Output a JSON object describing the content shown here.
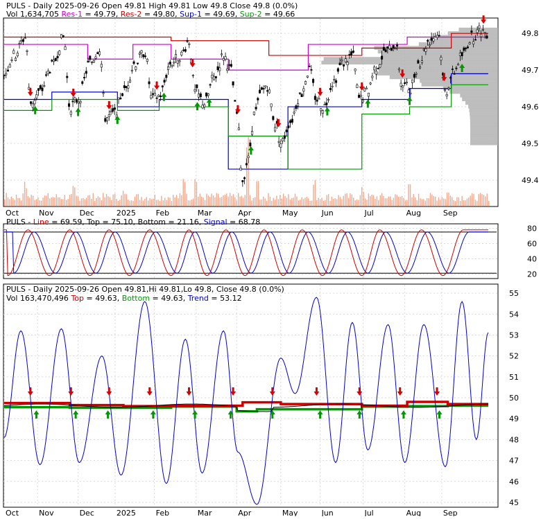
{
  "panel1": {
    "header_line1": [
      {
        "text": "PULS - Daily 2025-09-26 Open 49.81  High 49.81  Low 49.8  Close 49.8 (0.0%)",
        "color": "#000000"
      }
    ],
    "header_line2": [
      {
        "text": "Vol 1,634,705 ",
        "color": "#000000"
      },
      {
        "text": "Res-1",
        "color": "#cc00cc"
      },
      {
        "text": " = 49.79, ",
        "color": "#000000"
      },
      {
        "text": "Res-2",
        "color": "#cc0000"
      },
      {
        "text": " = 49.80, ",
        "color": "#000000"
      },
      {
        "text": "Sup-1",
        "color": "#0000cc"
      },
      {
        "text": " = 49.69, ",
        "color": "#000000"
      },
      {
        "text": "Sup-2",
        "color": "#009900"
      },
      {
        "text": " = 49.66",
        "color": "#000000"
      }
    ]
  },
  "panel2": {
    "header_line1": [
      {
        "text": "PULS - ",
        "color": "#000000"
      },
      {
        "text": "Line",
        "color": "#cc0000"
      },
      {
        "text": " = 69.59, ",
        "color": "#000000"
      },
      {
        "text": "Top",
        "color": "#000000"
      },
      {
        "text": " = 75.10, ",
        "color": "#000000"
      },
      {
        "text": "Bottom",
        "color": "#000000"
      },
      {
        "text": " = 21.16, ",
        "color": "#000000"
      },
      {
        "text": "Signal",
        "color": "#0000cc"
      },
      {
        "text": " = 68.78",
        "color": "#000000"
      }
    ]
  },
  "panel3": {
    "header_line1": [
      {
        "text": "PULS - Daily 2025-09-26 Open 49.81,Hi 49.81,Lo 49.8, Close 49.8 (0.0%)",
        "color": "#000000"
      }
    ],
    "header_line2": [
      {
        "text": "Vol 163,470,496 ",
        "color": "#000000"
      },
      {
        "text": "Top",
        "color": "#cc0000"
      },
      {
        "text": " = 49.63, ",
        "color": "#000000"
      },
      {
        "text": "Bottom",
        "color": "#009900"
      },
      {
        "text": " = 49.63, ",
        "color": "#000000"
      },
      {
        "text": "Trend",
        "color": "#0000cc"
      },
      {
        "text": " = 53.12",
        "color": "#000000"
      }
    ]
  },
  "colors": {
    "res1": "#cc00cc",
    "res2": "#cc0000",
    "sup1": "#0000cc",
    "sup2": "#009900",
    "volume": "#f4a88c",
    "profile": "#b3b3b3",
    "grid": "#d9d9d9",
    "up_arrow": "#009900",
    "down_arrow": "#dd0000"
  },
  "chart_data": [
    {
      "type": "candlestick",
      "title": "PULS - Daily 2025-09-26",
      "y_ticks": [
        "49.4",
        "49.5",
        "49.6",
        "49.7",
        "49.8"
      ],
      "ylim": [
        49.33,
        49.84
      ],
      "x_labels": [
        "Oct",
        "Nov",
        "Dec",
        "2025",
        "Feb",
        "Mar",
        "Apr",
        "May",
        "Jun",
        "Jul",
        "Aug",
        "Sep"
      ],
      "x_label_days": [
        0,
        28,
        62,
        93,
        126,
        161,
        195,
        232,
        265,
        301,
        336,
        367
      ],
      "total_days": 413,
      "grid": true,
      "last": {
        "open": 49.81,
        "high": 49.81,
        "low": 49.8,
        "close": 49.8
      },
      "series": [
        {
          "name": "Res-1",
          "value": 49.79
        },
        {
          "name": "Res-2",
          "value": 49.8
        },
        {
          "name": "Sup-1",
          "value": 49.69
        },
        {
          "name": "Sup-2",
          "value": 49.66
        }
      ],
      "price_anchors": [
        [
          0,
          49.69
        ],
        [
          8,
          49.74
        ],
        [
          18,
          49.79
        ],
        [
          22,
          49.61
        ],
        [
          30,
          49.64
        ],
        [
          40,
          49.71
        ],
        [
          50,
          49.79
        ],
        [
          55,
          49.6
        ],
        [
          62,
          49.62
        ],
        [
          72,
          49.72
        ],
        [
          80,
          49.76
        ],
        [
          85,
          49.57
        ],
        [
          92,
          49.58
        ],
        [
          100,
          49.64
        ],
        [
          110,
          49.72
        ],
        [
          118,
          49.75
        ],
        [
          124,
          49.62
        ],
        [
          130,
          49.63
        ],
        [
          140,
          49.72
        ],
        [
          148,
          49.74
        ],
        [
          155,
          49.78
        ],
        [
          160,
          49.64
        ],
        [
          168,
          49.61
        ],
        [
          176,
          49.68
        ],
        [
          184,
          49.74
        ],
        [
          190,
          49.7
        ],
        [
          195,
          49.58
        ],
        [
          200,
          49.4
        ],
        [
          204,
          49.45
        ],
        [
          210,
          49.58
        ],
        [
          216,
          49.64
        ],
        [
          220,
          49.66
        ],
        [
          228,
          49.55
        ],
        [
          232,
          49.5
        ],
        [
          240,
          49.56
        ],
        [
          248,
          49.63
        ],
        [
          256,
          49.7
        ],
        [
          262,
          49.62
        ],
        [
          268,
          49.6
        ],
        [
          276,
          49.67
        ],
        [
          284,
          49.72
        ],
        [
          292,
          49.74
        ],
        [
          298,
          49.62
        ],
        [
          304,
          49.64
        ],
        [
          312,
          49.71
        ],
        [
          320,
          49.75
        ],
        [
          328,
          49.77
        ],
        [
          334,
          49.66
        ],
        [
          340,
          49.65
        ],
        [
          348,
          49.72
        ],
        [
          356,
          49.78
        ],
        [
          364,
          49.8
        ],
        [
          370,
          49.64
        ],
        [
          376,
          49.69
        ],
        [
          384,
          49.74
        ],
        [
          392,
          49.79
        ],
        [
          400,
          49.81
        ],
        [
          406,
          49.8
        ]
      ],
      "volume_max": 23000000,
      "volume_spikes": [
        [
          17,
          8000000
        ],
        [
          58,
          6500000
        ],
        [
          100,
          5500000
        ],
        [
          150,
          12000000
        ],
        [
          160,
          10000000
        ],
        [
          204,
          23000000
        ],
        [
          212,
          9000000
        ],
        [
          260,
          8500000
        ],
        [
          300,
          6000000
        ],
        [
          340,
          7000000
        ],
        [
          372,
          5000000
        ]
      ],
      "res1_segments": [
        [
          0,
          35,
          49.77
        ],
        [
          35,
          70,
          49.77
        ],
        [
          70,
          108,
          49.73
        ],
        [
          108,
          140,
          49.77
        ],
        [
          140,
          188,
          49.73
        ],
        [
          188,
          255,
          49.7
        ],
        [
          255,
          300,
          49.77
        ],
        [
          300,
          338,
          49.77
        ],
        [
          338,
          375,
          49.79
        ],
        [
          375,
          406,
          49.79
        ]
      ],
      "res2_segments": [
        [
          0,
          70,
          49.79
        ],
        [
          70,
          140,
          49.79
        ],
        [
          140,
          222,
          49.78
        ],
        [
          222,
          300,
          49.74
        ],
        [
          300,
          375,
          49.76
        ],
        [
          375,
          406,
          49.8
        ]
      ],
      "sup1_segments": [
        [
          0,
          40,
          49.62
        ],
        [
          40,
          95,
          49.64
        ],
        [
          95,
          130,
          49.6
        ],
        [
          130,
          188,
          49.62
        ],
        [
          188,
          238,
          49.43
        ],
        [
          238,
          300,
          49.6
        ],
        [
          300,
          340,
          49.62
        ],
        [
          340,
          375,
          49.65
        ],
        [
          375,
          406,
          49.69
        ]
      ],
      "sup2_segments": [
        [
          0,
          40,
          49.59
        ],
        [
          40,
          95,
          49.62
        ],
        [
          95,
          130,
          49.59
        ],
        [
          130,
          188,
          49.6
        ],
        [
          188,
          238,
          49.52
        ],
        [
          238,
          300,
          49.43
        ],
        [
          300,
          340,
          49.58
        ],
        [
          340,
          375,
          49.6
        ],
        [
          375,
          406,
          49.66
        ]
      ],
      "buy_days": [
        26,
        62,
        95,
        134,
        162,
        172,
        207,
        271,
        305,
        340,
        384
      ],
      "sell_days": [
        22,
        58,
        88,
        128,
        158,
        196,
        230,
        265,
        300,
        334,
        369,
        402
      ]
    },
    {
      "type": "line",
      "title": "PULS - Line",
      "y_ticks": [
        "20",
        "40",
        "60",
        "80"
      ],
      "ylim": [
        15,
        85
      ],
      "series": [
        {
          "name": "Line",
          "last": 69.59
        },
        {
          "name": "Signal",
          "last": 68.78
        }
      ],
      "top_value": 75.1,
      "bottom_value": 21.16,
      "peak_days": [
        20,
        55,
        88,
        122,
        155,
        186,
        218,
        250,
        283,
        315,
        350,
        385,
        406
      ],
      "trough_days": [
        3,
        38,
        72,
        105,
        140,
        170,
        202,
        234,
        267,
        300,
        333,
        368
      ]
    },
    {
      "type": "line",
      "title": "PULS - Daily 2025-09-26",
      "y_ticks": [
        "45",
        "46",
        "47",
        "48",
        "49",
        "50",
        "51",
        "52",
        "53",
        "54",
        "55"
      ],
      "ylim": [
        44.8,
        55.4
      ],
      "series": [
        {
          "name": "Top",
          "value": 49.63
        },
        {
          "name": "Bottom",
          "value": 49.63
        },
        {
          "name": "Trend",
          "value": 53.12
        }
      ],
      "trend_anchors": [
        [
          0,
          48.1
        ],
        [
          14,
          53.2
        ],
        [
          30,
          46.8
        ],
        [
          48,
          53.3
        ],
        [
          63,
          46.9
        ],
        [
          82,
          52.0
        ],
        [
          98,
          46.3
        ],
        [
          118,
          54.6
        ],
        [
          136,
          45.9
        ],
        [
          152,
          52.8
        ],
        [
          166,
          46.4
        ],
        [
          184,
          53.2
        ],
        [
          196,
          47.4
        ],
        [
          212,
          44.9
        ],
        [
          232,
          51.9
        ],
        [
          244,
          50.2
        ],
        [
          262,
          54.8
        ],
        [
          278,
          46.9
        ],
        [
          292,
          53.6
        ],
        [
          305,
          47.5
        ],
        [
          322,
          53.5
        ],
        [
          336,
          46.9
        ],
        [
          352,
          53.5
        ],
        [
          370,
          46.7
        ],
        [
          384,
          54.6
        ],
        [
          396,
          48.0
        ],
        [
          406,
          53.12
        ]
      ],
      "top_segments": [
        [
          0,
          55,
          49.75
        ],
        [
          55,
          100,
          49.65
        ],
        [
          100,
          140,
          49.6
        ],
        [
          140,
          200,
          49.62
        ],
        [
          200,
          232,
          49.78
        ],
        [
          232,
          300,
          49.7
        ],
        [
          300,
          338,
          49.62
        ],
        [
          338,
          372,
          49.8
        ],
        [
          372,
          406,
          49.7
        ]
      ],
      "bottom_segments": [
        [
          0,
          55,
          49.55
        ],
        [
          55,
          100,
          49.52
        ],
        [
          100,
          140,
          49.52
        ],
        [
          140,
          195,
          49.58
        ],
        [
          195,
          212,
          49.35
        ],
        [
          212,
          300,
          49.45
        ],
        [
          300,
          338,
          49.58
        ],
        [
          338,
          372,
          49.6
        ],
        [
          372,
          406,
          49.63
        ]
      ],
      "buy_days": [
        27,
        60,
        87,
        125,
        160,
        190,
        225,
        265,
        298,
        335,
        365
      ],
      "sell_days": [
        22,
        56,
        88,
        122,
        155,
        192,
        225,
        262,
        298,
        332,
        363
      ]
    }
  ]
}
